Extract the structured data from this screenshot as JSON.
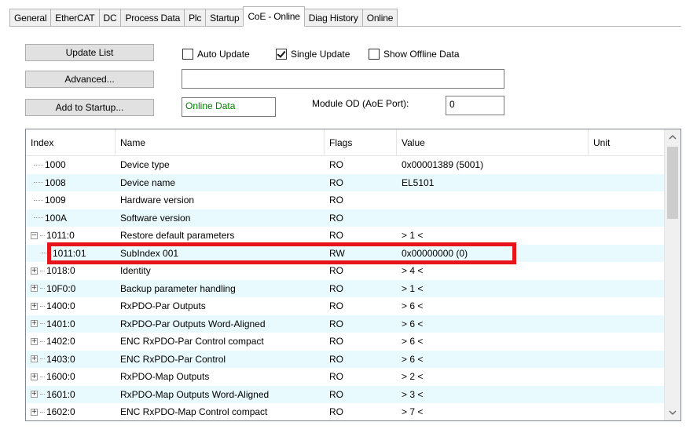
{
  "tabs": [
    {
      "label": "General",
      "active": false
    },
    {
      "label": "EtherCAT",
      "active": false
    },
    {
      "label": "DC",
      "active": false
    },
    {
      "label": "Process Data",
      "active": false
    },
    {
      "label": "Plc",
      "active": false
    },
    {
      "label": "Startup",
      "active": false
    },
    {
      "label": "CoE - Online",
      "active": true
    },
    {
      "label": "Diag History",
      "active": false
    },
    {
      "label": "Online",
      "active": false
    }
  ],
  "toolbar": {
    "update_list": "Update List",
    "advanced": "Advanced...",
    "add_to_startup": "Add to Startup...",
    "auto_update": {
      "label": "Auto Update",
      "checked": false
    },
    "single_update": {
      "label": "Single Update",
      "checked": true
    },
    "show_offline": {
      "label": "Show Offline Data",
      "checked": false
    },
    "filter_value": "",
    "online_data": "Online Data",
    "module_od_label": "Module OD (AoE Port):",
    "module_od_value": "0"
  },
  "list": {
    "columns": [
      "Index",
      "Name",
      "Flags",
      "Value",
      "Unit"
    ],
    "rows": [
      {
        "index": "1000",
        "name": "Device type",
        "flags": "RO",
        "value": "0x00001389 (5001)",
        "unit": "",
        "tree": "line"
      },
      {
        "index": "1008",
        "name": "Device name",
        "flags": "RO",
        "value": "EL5101",
        "unit": "",
        "tree": "line"
      },
      {
        "index": "1009",
        "name": "Hardware version",
        "flags": "RO",
        "value": "",
        "unit": "",
        "tree": "line"
      },
      {
        "index": "100A",
        "name": "Software version",
        "flags": "RO",
        "value": "",
        "unit": "",
        "tree": "line"
      },
      {
        "index": "1011:0",
        "name": "Restore default parameters",
        "flags": "RO",
        "value": "> 1 <",
        "unit": "",
        "tree": "minus"
      },
      {
        "index": "1011:01",
        "name": "SubIndex 001",
        "flags": "RW",
        "value": "0x00000000 (0)",
        "unit": "",
        "tree": "child"
      },
      {
        "index": "1018:0",
        "name": "Identity",
        "flags": "RO",
        "value": "> 4 <",
        "unit": "",
        "tree": "plus"
      },
      {
        "index": "10F0:0",
        "name": "Backup parameter handling",
        "flags": "RO",
        "value": "> 1 <",
        "unit": "",
        "tree": "plus"
      },
      {
        "index": "1400:0",
        "name": "RxPDO-Par Outputs",
        "flags": "RO",
        "value": "> 6 <",
        "unit": "",
        "tree": "plus"
      },
      {
        "index": "1401:0",
        "name": "RxPDO-Par Outputs Word-Aligned",
        "flags": "RO",
        "value": "> 6 <",
        "unit": "",
        "tree": "plus"
      },
      {
        "index": "1402:0",
        "name": "ENC RxPDO-Par Control compact",
        "flags": "RO",
        "value": "> 6 <",
        "unit": "",
        "tree": "plus"
      },
      {
        "index": "1403:0",
        "name": "ENC RxPDO-Par Control",
        "flags": "RO",
        "value": "> 6 <",
        "unit": "",
        "tree": "plus"
      },
      {
        "index": "1600:0",
        "name": "RxPDO-Map Outputs",
        "flags": "RO",
        "value": "> 2 <",
        "unit": "",
        "tree": "plus"
      },
      {
        "index": "1601:0",
        "name": "RxPDO-Map Outputs Word-Aligned",
        "flags": "RO",
        "value": "> 3 <",
        "unit": "",
        "tree": "plus"
      },
      {
        "index": "1602:0",
        "name": "ENC RxPDO-Map Control compact",
        "flags": "RO",
        "value": "> 7 <",
        "unit": "",
        "tree": "plus"
      }
    ]
  },
  "colors": {
    "highlight": "#e8141c",
    "alt_row": "#e8fafd"
  }
}
